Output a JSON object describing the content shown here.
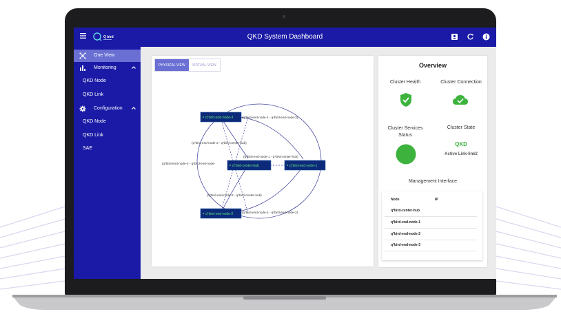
{
  "app": {
    "title": "QKD System Dashboard",
    "logo_text": "Q bird"
  },
  "colors": {
    "primary": "#1a1aa6",
    "active_item": "#6a6fd4",
    "health_green": "#3db33d",
    "node_fill": "#0d2a7a",
    "node_text": "#5fe07a"
  },
  "toolbar": {
    "icons": [
      "account-box-icon",
      "refresh-icon",
      "info-icon"
    ]
  },
  "sidebar": {
    "items": [
      {
        "label": "One View",
        "icon": "network-icon",
        "active": true
      },
      {
        "label": "Monitoring",
        "icon": "bar-chart-icon",
        "expanded": true
      },
      {
        "label": "QKD Node"
      },
      {
        "label": "QKD Link"
      },
      {
        "label": "Configuration",
        "icon": "gear-icon",
        "expanded": true
      },
      {
        "label": "QKD Node"
      },
      {
        "label": "QKD Link"
      },
      {
        "label": "SAE"
      }
    ]
  },
  "view_tabs": {
    "physical": "PHYSICAL VIEW",
    "virtual": "VIRTUAL VIEW",
    "selected": "PHYSICAL VIEW"
  },
  "graph": {
    "nodes": [
      {
        "id": "end3",
        "label": "q*bird-end-node-3"
      },
      {
        "id": "hub",
        "label": "q*bird-center-hub"
      },
      {
        "id": "end1",
        "label": "q*bird-end-node-1"
      },
      {
        "id": "end2",
        "label": "q*bird-end-node-2"
      }
    ],
    "edge_labels": [
      "(q*bird-end-node-1 - q*bird-end-node-3)",
      "(q*bird-end-node-3 - q*bird-center-hub)",
      "(q*bird-end-node-1 - q*bird-center-hub)",
      "(q*bird-end-node-2 - q*bird-end-node-",
      "(q*bird-end-node-2 - q*bird-center-hub)",
      "(q*bird-end-node-1 - q*bird-end-node-2)"
    ]
  },
  "overview": {
    "title": "Overview",
    "cluster_health": "Cluster Health",
    "cluster_connection": "Cluster Connection",
    "cluster_services_status": "Cluster Services Status",
    "cluster_state": "Cluster State",
    "state_value": "QKD",
    "state_detail": "Active Link-link2",
    "management_title": "Management Interface",
    "table": {
      "headers": [
        "Node",
        "IP"
      ],
      "rows": [
        "q*bird-center-hub",
        "q*bird-end-node-1",
        "q*bird-end-node-2",
        "q*bird-end-node-3"
      ]
    }
  }
}
